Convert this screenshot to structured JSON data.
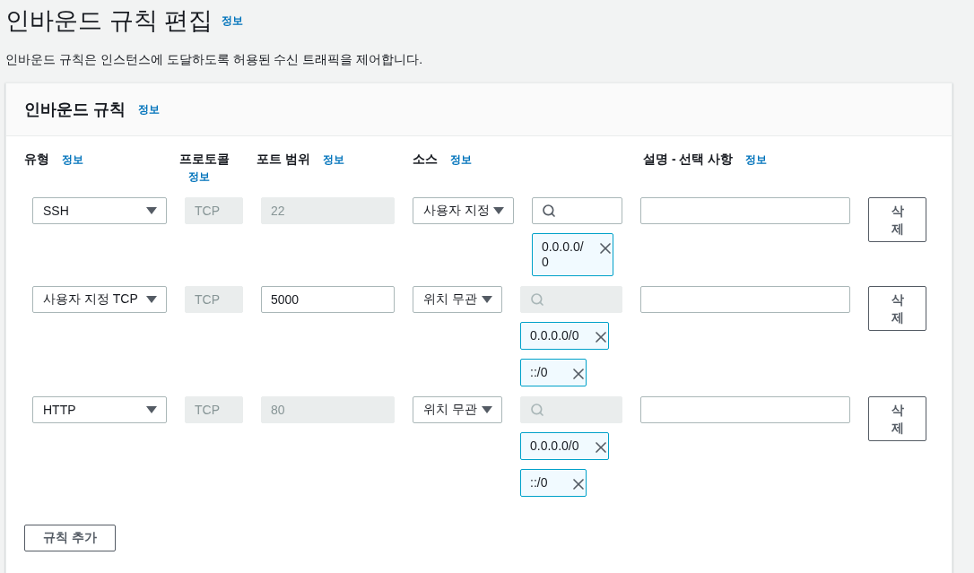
{
  "page": {
    "title": "인바운드 규칙 편집",
    "title_info": "정보",
    "description": "인바운드 규칙은 인스턴스에 도달하도록 허용된 수신 트래픽을 제어합니다."
  },
  "panel": {
    "heading": "인바운드 규칙",
    "heading_info": "정보",
    "columns": [
      {
        "label": "유형",
        "info": "정보"
      },
      {
        "label": "프로토콜",
        "info": "정보"
      },
      {
        "label": "포트 범위",
        "info": "정보"
      },
      {
        "label": "소스",
        "info": "정보"
      },
      {
        "label": "설명 - 선택 사항",
        "info": "정보"
      }
    ],
    "rules": [
      {
        "type": "SSH",
        "protocol": {
          "value": "TCP",
          "disabled": true
        },
        "port": {
          "value": "22",
          "disabled": true
        },
        "source": "사용자 지정",
        "cidr_search": {
          "disabled": false
        },
        "cidrs": [
          "0.0.0.0/0"
        ],
        "delete_label": "삭제"
      },
      {
        "type": "사용자 지정 TCP",
        "protocol": {
          "value": "TCP",
          "disabled": true
        },
        "port": {
          "value": "5000",
          "disabled": false
        },
        "source": "위치 무관",
        "cidr_search": {
          "disabled": true
        },
        "cidrs": [
          "0.0.0.0/0",
          "::/0"
        ],
        "delete_label": "삭제"
      },
      {
        "type": "HTTP",
        "protocol": {
          "value": "TCP",
          "disabled": true
        },
        "port": {
          "value": "80",
          "disabled": true
        },
        "source": "위치 무관",
        "cidr_search": {
          "disabled": true
        },
        "cidrs": [
          "0.0.0.0/0",
          "::/0"
        ],
        "delete_label": "삭제"
      }
    ],
    "add_button": "규칙 추가"
  }
}
